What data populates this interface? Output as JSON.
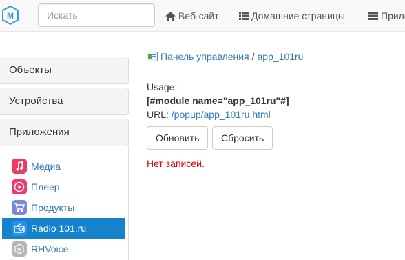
{
  "navbar": {
    "search_placeholder": "Искать",
    "links": [
      "Веб-сайт",
      "Домашние страницы",
      "Прило"
    ]
  },
  "sidebar": {
    "sections": [
      "Объекты",
      "Устройства",
      "Приложения"
    ],
    "apps": [
      {
        "label": "Медиа",
        "icon": "music-icon",
        "color": "#ee3a63"
      },
      {
        "label": "Плеер",
        "icon": "play-icon",
        "color": "#ee3a6f"
      },
      {
        "label": "Продукты",
        "icon": "cart-icon",
        "color": "#7b87d9"
      },
      {
        "label": "Radio 101.ru",
        "icon": "radio-icon",
        "color": "#2b8ff2",
        "active": true
      },
      {
        "label": "RHVoice",
        "icon": "module-icon",
        "color": "#b5b5b5"
      }
    ]
  },
  "breadcrumb": {
    "root": "Панель управления",
    "separator": "/",
    "current": "app_101ru"
  },
  "usage": {
    "label": "Usage:",
    "code": "[#module name=\"app_101ru\"#]",
    "url_label": "URL:",
    "url": "/popup/app_101ru.html"
  },
  "buttons": {
    "refresh": "Обновить",
    "reset": "Сбросить"
  },
  "empty_message": "Нет записей.",
  "colors": {
    "accent": "#337ab7",
    "active_bg": "#1583cc",
    "error": "#d9000d"
  }
}
